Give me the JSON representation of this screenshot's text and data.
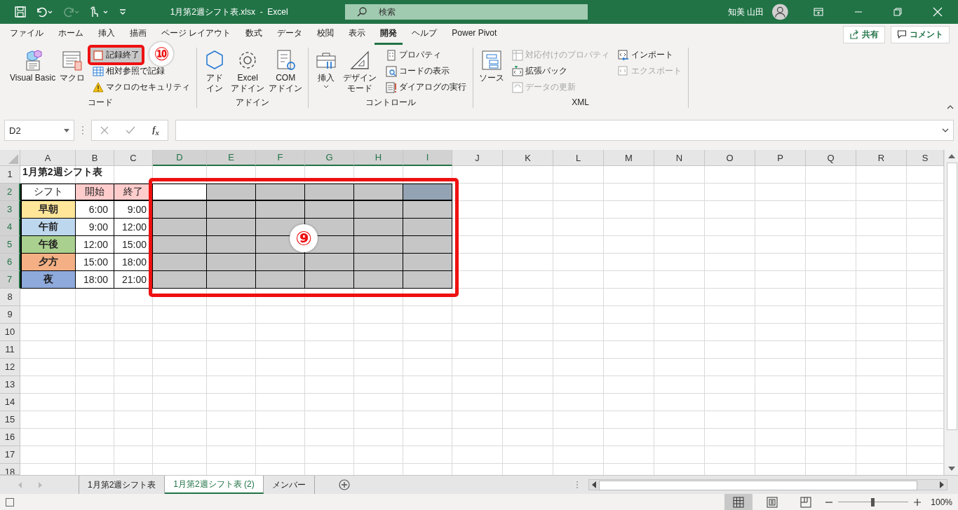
{
  "title_bar": {
    "title": "1月第2週シフト表.xlsx  -  Excel",
    "search_placeholder": "検索",
    "user_name": "知美 山田"
  },
  "ribbon_tabs": [
    {
      "label": "ファイル",
      "selected": false
    },
    {
      "label": "ホーム",
      "selected": false
    },
    {
      "label": "挿入",
      "selected": false
    },
    {
      "label": "描画",
      "selected": false
    },
    {
      "label": "ページ レイアウト",
      "selected": false
    },
    {
      "label": "数式",
      "selected": false
    },
    {
      "label": "データ",
      "selected": false
    },
    {
      "label": "校閲",
      "selected": false
    },
    {
      "label": "表示",
      "selected": false
    },
    {
      "label": "開発",
      "selected": true
    },
    {
      "label": "ヘルプ",
      "selected": false
    },
    {
      "label": "Power Pivot",
      "selected": false
    }
  ],
  "share_button": "共有",
  "comment_button": "コメント",
  "ribbon_groups": [
    {
      "label": "コード",
      "large": [
        {
          "kind": "vb",
          "label": "Visual Basic"
        },
        {
          "kind": "macro",
          "label": "マクロ"
        }
      ],
      "columns": [
        [
          {
            "kind": "stop",
            "label": "記録終了",
            "disabled": false,
            "highlighted": true,
            "callout": "⑩"
          },
          {
            "kind": "relative",
            "label": "相対参照で記録",
            "disabled": false,
            "highlighted": false
          },
          {
            "kind": "warning",
            "label": "マクロのセキュリティ",
            "disabled": false,
            "highlighted": false
          }
        ]
      ]
    },
    {
      "label": "アドイン",
      "large": [
        {
          "kind": "addin",
          "label": "アドイン"
        },
        {
          "kind": "gear",
          "label": "Excel\nアドイン"
        },
        {
          "kind": "com",
          "label": "COM\nアドイン"
        }
      ]
    },
    {
      "label": "コントロール",
      "large": [
        {
          "kind": "toolbox",
          "label": "挿入",
          "dropdown": true
        },
        {
          "kind": "ruler",
          "label": "デザインモード"
        }
      ],
      "columns": [
        [
          {
            "kind": "props",
            "label": "プロパティ",
            "disabled": false,
            "highlighted": false
          },
          {
            "kind": "code",
            "label": "コードの表示",
            "disabled": false,
            "highlighted": false
          },
          {
            "kind": "dialog",
            "label": "ダイアログの実行",
            "disabled": false,
            "highlighted": false
          }
        ]
      ]
    },
    {
      "label": "XML",
      "large": [
        {
          "kind": "source",
          "label": "ソース"
        }
      ],
      "columns": [
        [
          {
            "kind": "map",
            "label": "対応付けのプロパティ",
            "disabled": true,
            "highlighted": false
          },
          {
            "kind": "pack",
            "label": "拡張パック",
            "disabled": false,
            "highlighted": false
          },
          {
            "kind": "refresh",
            "label": "データの更新",
            "disabled": true,
            "highlighted": false
          }
        ],
        [
          {
            "kind": "import",
            "label": "インポート",
            "disabled": false,
            "highlighted": false
          },
          {
            "kind": "export",
            "label": "エクスポート",
            "disabled": true,
            "highlighted": false
          }
        ]
      ]
    }
  ],
  "formula_bar": {
    "name_box": "D2",
    "function_label": "f$_{x}$"
  },
  "sheet": {
    "callout": "⑨",
    "columns": [
      {
        "label": "A",
        "selected": false
      },
      {
        "label": "B",
        "selected": false
      },
      {
        "label": "C",
        "selected": false
      },
      {
        "label": "D",
        "selected": true
      },
      {
        "label": "E",
        "selected": true
      },
      {
        "label": "F",
        "selected": true
      },
      {
        "label": "G",
        "selected": true
      },
      {
        "label": "H",
        "selected": true
      },
      {
        "label": "I",
        "selected": true
      },
      {
        "label": "J",
        "selected": false
      },
      {
        "label": "K",
        "selected": false
      },
      {
        "label": "L",
        "selected": false
      },
      {
        "label": "M",
        "selected": false
      },
      {
        "label": "N",
        "selected": false
      },
      {
        "label": "O",
        "selected": false
      },
      {
        "label": "P",
        "selected": false
      },
      {
        "label": "Q",
        "selected": false
      },
      {
        "label": "R",
        "selected": false
      },
      {
        "label": "S",
        "selected": false
      }
    ],
    "rows": [
      {
        "label": "1",
        "selected": false,
        "cells": [
          {
            "kind": "title",
            "text": "1月第2週シフト表"
          }
        ]
      },
      {
        "label": "2",
        "selected": true,
        "cells": [
          {
            "kind": "header",
            "text": "シフト",
            "color": "#ffffff"
          },
          {
            "kind": "header",
            "text": "開始",
            "color": "#ffcccc"
          },
          {
            "kind": "header",
            "text": "終了",
            "color": "#ffcccc"
          },
          {
            "kind": "range",
            "active": true
          },
          {
            "kind": "range",
            "active": false
          },
          {
            "kind": "range",
            "active": false
          },
          {
            "kind": "range",
            "active": false
          },
          {
            "kind": "range",
            "active": false
          },
          {
            "kind": "range",
            "active": false,
            "color": "#94a3b3"
          }
        ]
      },
      {
        "label": "3",
        "selected": true,
        "cells": [
          {
            "kind": "label",
            "text": "早朝",
            "color": "#ffe699"
          },
          {
            "kind": "time",
            "text": "6:00"
          },
          {
            "kind": "time",
            "text": "9:00"
          },
          {
            "kind": "range",
            "active": false
          },
          {
            "kind": "range",
            "active": false
          },
          {
            "kind": "range",
            "active": false
          },
          {
            "kind": "range",
            "active": false
          },
          {
            "kind": "range",
            "active": false
          },
          {
            "kind": "range",
            "active": false
          }
        ]
      },
      {
        "label": "4",
        "selected": true,
        "cells": [
          {
            "kind": "label",
            "text": "午前",
            "color": "#bdd7ee"
          },
          {
            "kind": "time",
            "text": "9:00"
          },
          {
            "kind": "time",
            "text": "12:00"
          },
          {
            "kind": "range",
            "active": false
          },
          {
            "kind": "range",
            "active": false
          },
          {
            "kind": "range",
            "active": false
          },
          {
            "kind": "range",
            "active": false
          },
          {
            "kind": "range",
            "active": false
          },
          {
            "kind": "range",
            "active": false
          }
        ]
      },
      {
        "label": "5",
        "selected": true,
        "cells": [
          {
            "kind": "label",
            "text": "午後",
            "color": "#a9d08e"
          },
          {
            "kind": "time",
            "text": "12:00"
          },
          {
            "kind": "time",
            "text": "15:00"
          },
          {
            "kind": "range",
            "active": false
          },
          {
            "kind": "range",
            "active": false
          },
          {
            "kind": "range",
            "active": false
          },
          {
            "kind": "range",
            "active": false
          },
          {
            "kind": "range",
            "active": false
          },
          {
            "kind": "range",
            "active": false
          }
        ]
      },
      {
        "label": "6",
        "selected": true,
        "cells": [
          {
            "kind": "label",
            "text": "夕方",
            "color": "#f4b084"
          },
          {
            "kind": "time",
            "text": "15:00"
          },
          {
            "kind": "time",
            "text": "18:00"
          },
          {
            "kind": "range",
            "active": false
          },
          {
            "kind": "range",
            "active": false
          },
          {
            "kind": "range",
            "active": false
          },
          {
            "kind": "range",
            "active": false
          },
          {
            "kind": "range",
            "active": false
          },
          {
            "kind": "range",
            "active": false
          }
        ]
      },
      {
        "label": "7",
        "selected": true,
        "cells": [
          {
            "kind": "label",
            "text": "夜",
            "color": "#8ea9db"
          },
          {
            "kind": "time",
            "text": "18:00"
          },
          {
            "kind": "time",
            "text": "21:00"
          },
          {
            "kind": "range",
            "active": false
          },
          {
            "kind": "range",
            "active": false
          },
          {
            "kind": "range",
            "active": false
          },
          {
            "kind": "range",
            "active": false
          },
          {
            "kind": "range",
            "active": false
          },
          {
            "kind": "range",
            "active": false
          }
        ]
      },
      {
        "label": "8",
        "selected": false
      },
      {
        "label": "9",
        "selected": false
      },
      {
        "label": "10",
        "selected": false
      },
      {
        "label": "11",
        "selected": false
      },
      {
        "label": "12",
        "selected": false
      },
      {
        "label": "13",
        "selected": false
      },
      {
        "label": "14",
        "selected": false
      },
      {
        "label": "15",
        "selected": false
      },
      {
        "label": "16",
        "selected": false
      },
      {
        "label": "17",
        "selected": false
      },
      {
        "label": "18",
        "selected": false
      }
    ]
  },
  "sheet_tabs": [
    {
      "label": "1月第2週シフト表",
      "selected": false
    },
    {
      "label": "1月第2週シフト表 (2)",
      "selected": true
    },
    {
      "label": "メンバー",
      "selected": false
    }
  ],
  "status_bar": {
    "views": [
      {
        "kind": "normal",
        "selected": true
      },
      {
        "kind": "page_layout",
        "selected": false
      },
      {
        "kind": "page_break",
        "selected": false
      }
    ],
    "zoom": {
      "level": 0.5,
      "reading": "100%"
    }
  }
}
